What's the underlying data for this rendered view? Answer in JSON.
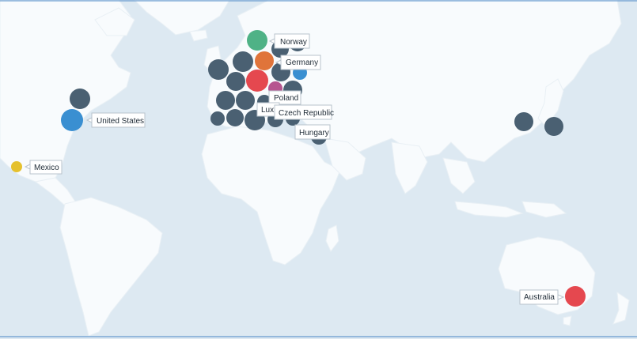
{
  "map": {
    "ocean_color": "#dde9f2",
    "land_color": "#f8fbfd",
    "default_bubble_color": "#4a6072",
    "labels": {
      "norway": "Norway",
      "germany": "Germany",
      "poland": "Poland",
      "luxembourg": "Luxe",
      "czech": "Czech Republic",
      "hungary": "Hungary",
      "usa": "United States",
      "mexico": "Mexico",
      "australia": "Australia"
    },
    "colors": {
      "norway": "#4fb286",
      "germany": "#e0743a",
      "highlight_red": "#e5484f",
      "poland": "#b6558f",
      "blue": "#3a8fd1",
      "mexico": "#e5c12e",
      "slate": "#4a6072"
    }
  }
}
